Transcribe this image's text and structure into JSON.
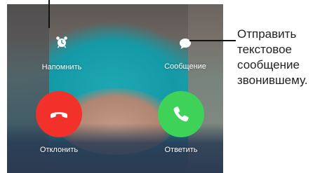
{
  "screen": {
    "remind": {
      "label": "Напомнить",
      "icon": "alarm-clock-icon"
    },
    "message": {
      "label": "Сообщение",
      "icon": "speech-bubble-icon"
    },
    "decline": {
      "label": "Отклонить",
      "icon": "phone-hangup-icon",
      "color": "#f2312a"
    },
    "accept": {
      "label": "Ответить",
      "icon": "phone-icon",
      "color": "#3fd259"
    }
  },
  "callout": {
    "lines": [
      "Отправить",
      "текстовое",
      "сообщение",
      "звонившему."
    ]
  }
}
